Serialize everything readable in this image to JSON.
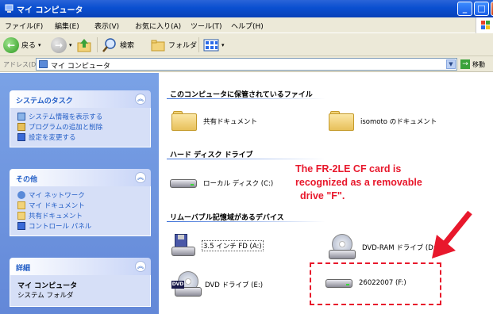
{
  "window": {
    "title": "マイ コンピュータ",
    "icon": "my-computer-icon"
  },
  "menubar": {
    "items": [
      "ファイル(F)",
      "編集(E)",
      "表示(V)",
      "お気に入り(A)",
      "ツール(T)",
      "ヘルプ(H)"
    ]
  },
  "toolbar": {
    "back_label": "戻る",
    "search_label": "検索",
    "folders_label": "フォルダ"
  },
  "address": {
    "label": "アドレス(D)",
    "value": "マイ コンピュータ",
    "go_label": "移動"
  },
  "tasks": {
    "system": {
      "title": "システムのタスク",
      "items": [
        "システム情報を表示する",
        "プログラムの追加と削除",
        "設定を変更する"
      ]
    },
    "other": {
      "title": "その他",
      "items": [
        "マイ ネットワーク",
        "マイ ドキュメント",
        "共有ドキュメント",
        "コントロール パネル"
      ]
    },
    "details": {
      "title": "詳細",
      "name": "マイ コンピュータ",
      "type": "システム フォルダ"
    }
  },
  "content": {
    "groups": {
      "files": "このコンピュータに保管されているファイル",
      "hdd": "ハード ディスク ドライブ",
      "removable": "リムーバブル記憶域があるデバイス"
    },
    "files": [
      "共有ドキュメント",
      "isomoto のドキュメント"
    ],
    "hdd": [
      "ローカル ディスク (C:)"
    ],
    "removable": [
      "3.5 インチ FD (A:)",
      "DVD-RAM ドライブ (D:)",
      "DVD ドライブ (E:)",
      "26022007 (F:)"
    ]
  },
  "annotation": {
    "line1": "The FR-2LE CF card is",
    "line2": "recognized as a removable",
    "line3": "drive \"F\".",
    "color": "#e8182c"
  }
}
